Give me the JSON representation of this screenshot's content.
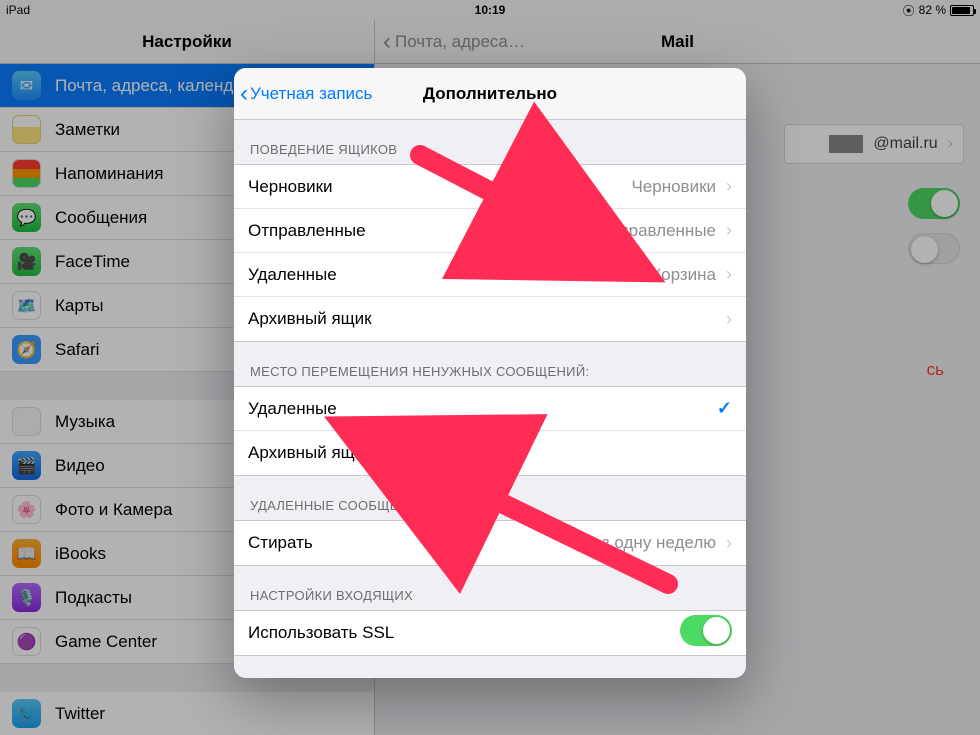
{
  "status": {
    "left": "iPad",
    "time": "10:19",
    "battery_pct": "82 %"
  },
  "sidebar": {
    "title": "Настройки",
    "items": [
      {
        "label": "Почта, адреса, календа…"
      },
      {
        "label": "Заметки"
      },
      {
        "label": "Напоминания"
      },
      {
        "label": "Сообщения"
      },
      {
        "label": "FaceTime"
      },
      {
        "label": "Карты"
      },
      {
        "label": "Safari"
      }
    ],
    "group2": [
      {
        "label": "Музыка"
      },
      {
        "label": "Видео"
      },
      {
        "label": "Фото и Камера"
      },
      {
        "label": "iBooks"
      },
      {
        "label": "Подкасты"
      },
      {
        "label": "Game Center"
      }
    ],
    "group3": [
      {
        "label": "Twitter"
      }
    ]
  },
  "detail": {
    "back": "Почта, адреса…",
    "title": "Mail",
    "account_domain": "@mail.ru",
    "delete_text": "сь"
  },
  "popover": {
    "back": "Учетная запись",
    "title": "Дополнительно",
    "group1_label": "ПОВЕДЕНИЕ ЯЩИКОВ",
    "mailbox_rows": [
      {
        "label": "Черновики",
        "value": "Черновики"
      },
      {
        "label": "Отправленные",
        "value": "Отправленные"
      },
      {
        "label": "Удаленные",
        "value": "Корзина"
      },
      {
        "label": "Архивный ящик",
        "value": ""
      }
    ],
    "group2_label": "МЕСТО ПЕРЕМЕЩЕНИЯ НЕНУЖНЫХ СООБЩЕНИЙ:",
    "move_rows": [
      {
        "label": "Удаленные",
        "checked": true
      },
      {
        "label": "Архивный ящик",
        "checked": false
      }
    ],
    "group3_label": "УДАЛЕННЫЕ СООБЩЕНИЯ",
    "erase": {
      "label": "Стирать",
      "value": "Через одну неделю"
    },
    "group4_label": "НАСТРОЙКИ ВХОДЯЩИХ",
    "ssl_label": "Использовать SSL"
  }
}
